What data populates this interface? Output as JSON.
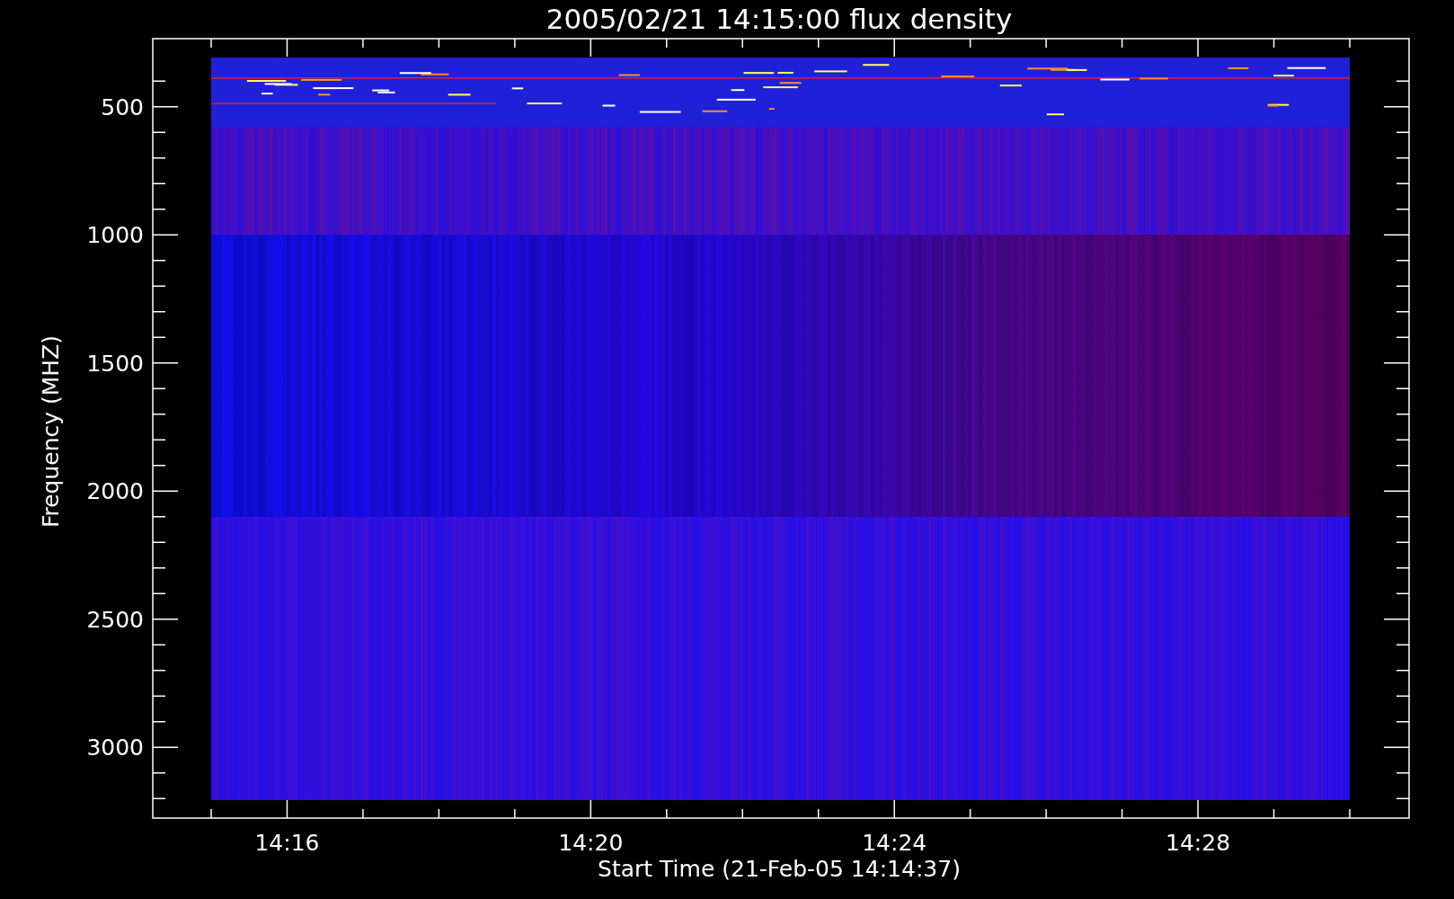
{
  "title": "2005/02/21 14:15:00 flux density",
  "y_axis": {
    "title": "Frequency (MHZ)",
    "tick_labels": [
      "500",
      "1000",
      "1500",
      "2000",
      "2500",
      "3000"
    ]
  },
  "x_axis": {
    "title": "Start Time (21-Feb-05 14:14:37)",
    "tick_labels": [
      "14:16",
      "14:20",
      "14:24",
      "14:28"
    ]
  }
}
